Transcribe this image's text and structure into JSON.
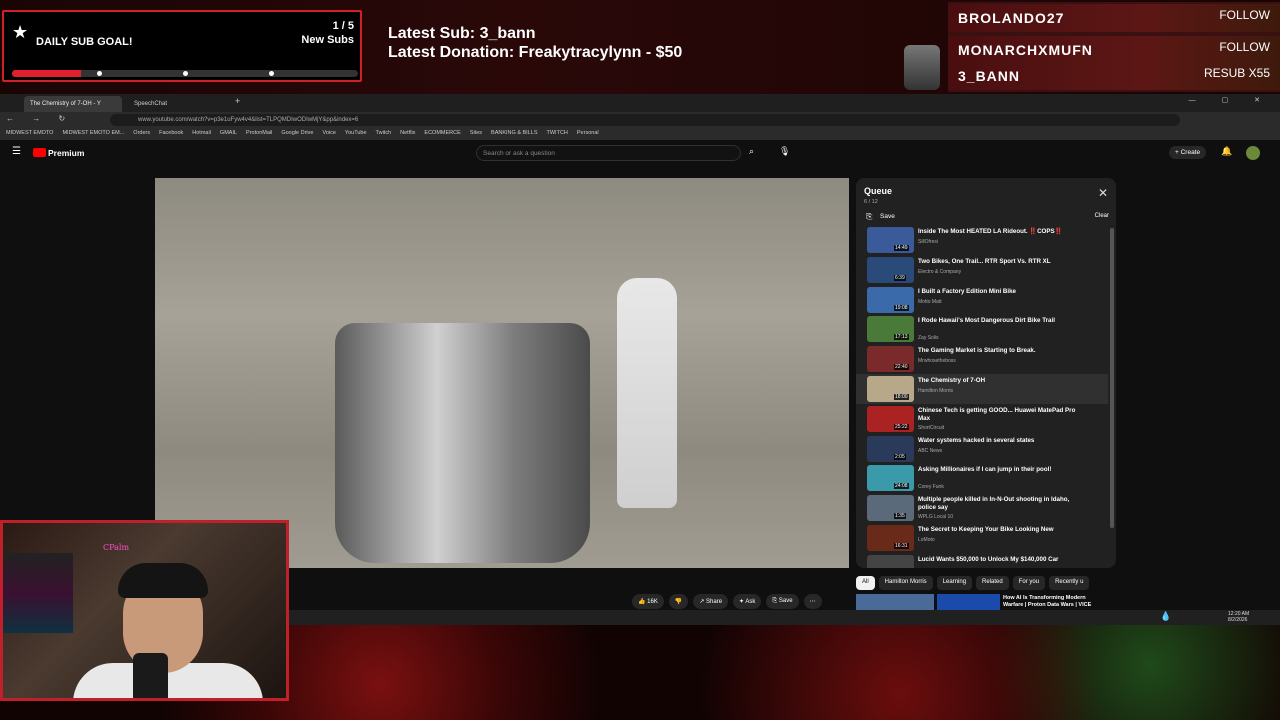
{
  "overlay": {
    "goal": {
      "title": "DAILY SUB GOAL!",
      "count": "1 / 5",
      "unit": "New Subs",
      "progress": 0.2
    },
    "latest_sub": "Latest Sub: 3_bann",
    "latest_donation": "Latest Donation: Freakytracylynn  - $50",
    "alerts": [
      {
        "name": "BROLANDO27",
        "action": "FOLLOW"
      },
      {
        "name": "MONARCHXMUFN",
        "action": "FOLLOW"
      },
      {
        "name": "3_BANN",
        "action": "RESUB X55"
      }
    ]
  },
  "browser": {
    "tabs": [
      {
        "label": "The Chemistry of 7-OH - Y",
        "active": true
      },
      {
        "label": "SpeechChat",
        "active": false
      }
    ],
    "url": "www.youtube.com/watch?v=p3e1uFyw4v4&list=TLPQMDIwODIwMjY&pp&index=6",
    "bookmarks": [
      "MIDWEST EMOTO",
      "MIDWEST EMOTO EM...",
      "Orders",
      "Facebook",
      "Hotmail",
      "GMAIL",
      "ProtonMail",
      "Google Drive",
      "Voice",
      "YouTube",
      "Twitch",
      "Netflix",
      "ECOMMERCE",
      "Sites",
      "BANKING & BILLS",
      "TWITCH",
      "Personal"
    ]
  },
  "youtube": {
    "logo": "Premium",
    "search_placeholder": "Search or ask a question",
    "create_label": "Create",
    "queue": {
      "title": "Queue",
      "position": "6 / 12",
      "save_label": "Save",
      "clear_label": "Clear",
      "items": [
        {
          "title": "Inside The Most HEATED LA Rideout. ‼️COPS‼️",
          "channel": "SillOfresi",
          "duration": "14:49",
          "color": "#3a5a9a"
        },
        {
          "title": "Two Bikes, One Trail... RTR Sport Vs. RTR XL",
          "channel": "Electro & Company",
          "duration": "6:39",
          "color": "#2a4a7a"
        },
        {
          "title": "I Built a Factory Edition Mini Bike",
          "channel": "Motto Matt",
          "duration": "19:08",
          "color": "#3a6aaa"
        },
        {
          "title": "I Rode Hawaii's Most Dangerous Dirt Bike Trail",
          "channel": "Zay Solis",
          "duration": "17:13",
          "color": "#4a7a3a"
        },
        {
          "title": "The Gaming Market is Starting to Break.",
          "channel": "Mrwhosetheboss",
          "duration": "22:40",
          "color": "#7a2a2a"
        },
        {
          "title": "The Chemistry of 7-OH",
          "channel": "Hamilton Morris",
          "duration": "18:00",
          "color": "#b8a88a"
        },
        {
          "title": "Chinese Tech is getting GOOD... Huawei MatePad Pro Max",
          "channel": "ShortCircuit",
          "duration": "25:22",
          "color": "#aa2222"
        },
        {
          "title": "Water systems hacked in several states",
          "channel": "ABC News",
          "duration": "2:05",
          "color": "#2a3a5a"
        },
        {
          "title": "Asking Millionaires if I can jump in their pool!",
          "channel": "Corey Funk",
          "duration": "24:08",
          "color": "#3a9aaa"
        },
        {
          "title": "Multiple people killed in In-N-Out shooting in Idaho, police say",
          "channel": "WPLG Local 10",
          "duration": "1:35",
          "color": "#5a6a7a"
        },
        {
          "title": "The Secret to Keeping Your Bike Looking New",
          "channel": "LoMoto",
          "duration": "16:31",
          "color": "#6a2a1a"
        },
        {
          "title": "Lucid Wants $50,000 to Unlock My $140,000 Car",
          "channel": "",
          "duration": "",
          "color": "#444"
        }
      ]
    },
    "chips": [
      "All",
      "Hamilton Morris",
      "Learning",
      "Related",
      "For you",
      "Recently u"
    ],
    "actions": {
      "likes": "16K",
      "share": "Share",
      "ask": "Ask",
      "save": "Save"
    },
    "rec_title": "How AI Is Transforming Modern Warfare | Proton Data Wars | VICE"
  },
  "taskbar": {
    "time": "12:20 AM",
    "date": "8/2/2026"
  },
  "webcam": {
    "sign": "CPalm"
  }
}
